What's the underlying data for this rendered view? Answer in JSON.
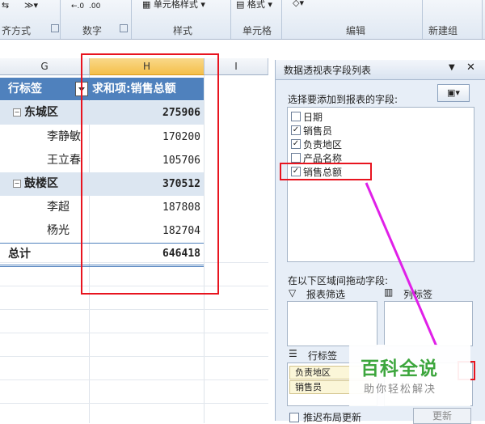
{
  "ribbon": {
    "alignment_label": "齐方式",
    "number_label": "数字",
    "styles_label": "样式",
    "cells_label": "单元格",
    "editing_label": "编辑",
    "newgroup_label": "新建组",
    "cell_style_button": "单元格样式",
    "format_button": "格式"
  },
  "sheet": {
    "columns": [
      "G",
      "H",
      "I"
    ],
    "header_row_label": "行标签",
    "header_value_label": "求和项:销售总额",
    "rows": [
      {
        "label": "东城区",
        "value": "275906",
        "level": "group"
      },
      {
        "label": "李静敏",
        "value": "170200",
        "level": "item"
      },
      {
        "label": "王立春",
        "value": "105706",
        "level": "item"
      },
      {
        "label": "鼓楼区",
        "value": "370512",
        "level": "group"
      },
      {
        "label": "李超",
        "value": "187808",
        "level": "item"
      },
      {
        "label": "杨光",
        "value": "182704",
        "level": "item"
      }
    ],
    "total_label": "总计",
    "total_value": "646418"
  },
  "pane": {
    "title": "数据透视表字段列表",
    "prompt": "选择要添加到报表的字段:",
    "fields": [
      {
        "label": "日期",
        "checked": false
      },
      {
        "label": "销售员",
        "checked": true
      },
      {
        "label": "负责地区",
        "checked": true
      },
      {
        "label": "产品名称",
        "checked": false
      },
      {
        "label": "销售总额",
        "checked": true
      }
    ],
    "drag_prompt": "在以下区域间拖动字段:",
    "report_filter_label": "报表筛选",
    "column_labels_label": "列标签",
    "row_labels_label": "行标签",
    "row_chips": [
      "负责地区",
      "销售员"
    ],
    "defer_update_label": "推迟布局更新",
    "update_button": "更新"
  },
  "watermark": {
    "main": "百科全说",
    "sub": "助你轻松解决"
  },
  "colors": {
    "pivot_header": "#4f81bd",
    "subtotal_fill": "#dce6f1",
    "highlight_red": "#e8141f",
    "arrow_magenta": "#e020e8",
    "watermark_green": "#3da63d"
  }
}
